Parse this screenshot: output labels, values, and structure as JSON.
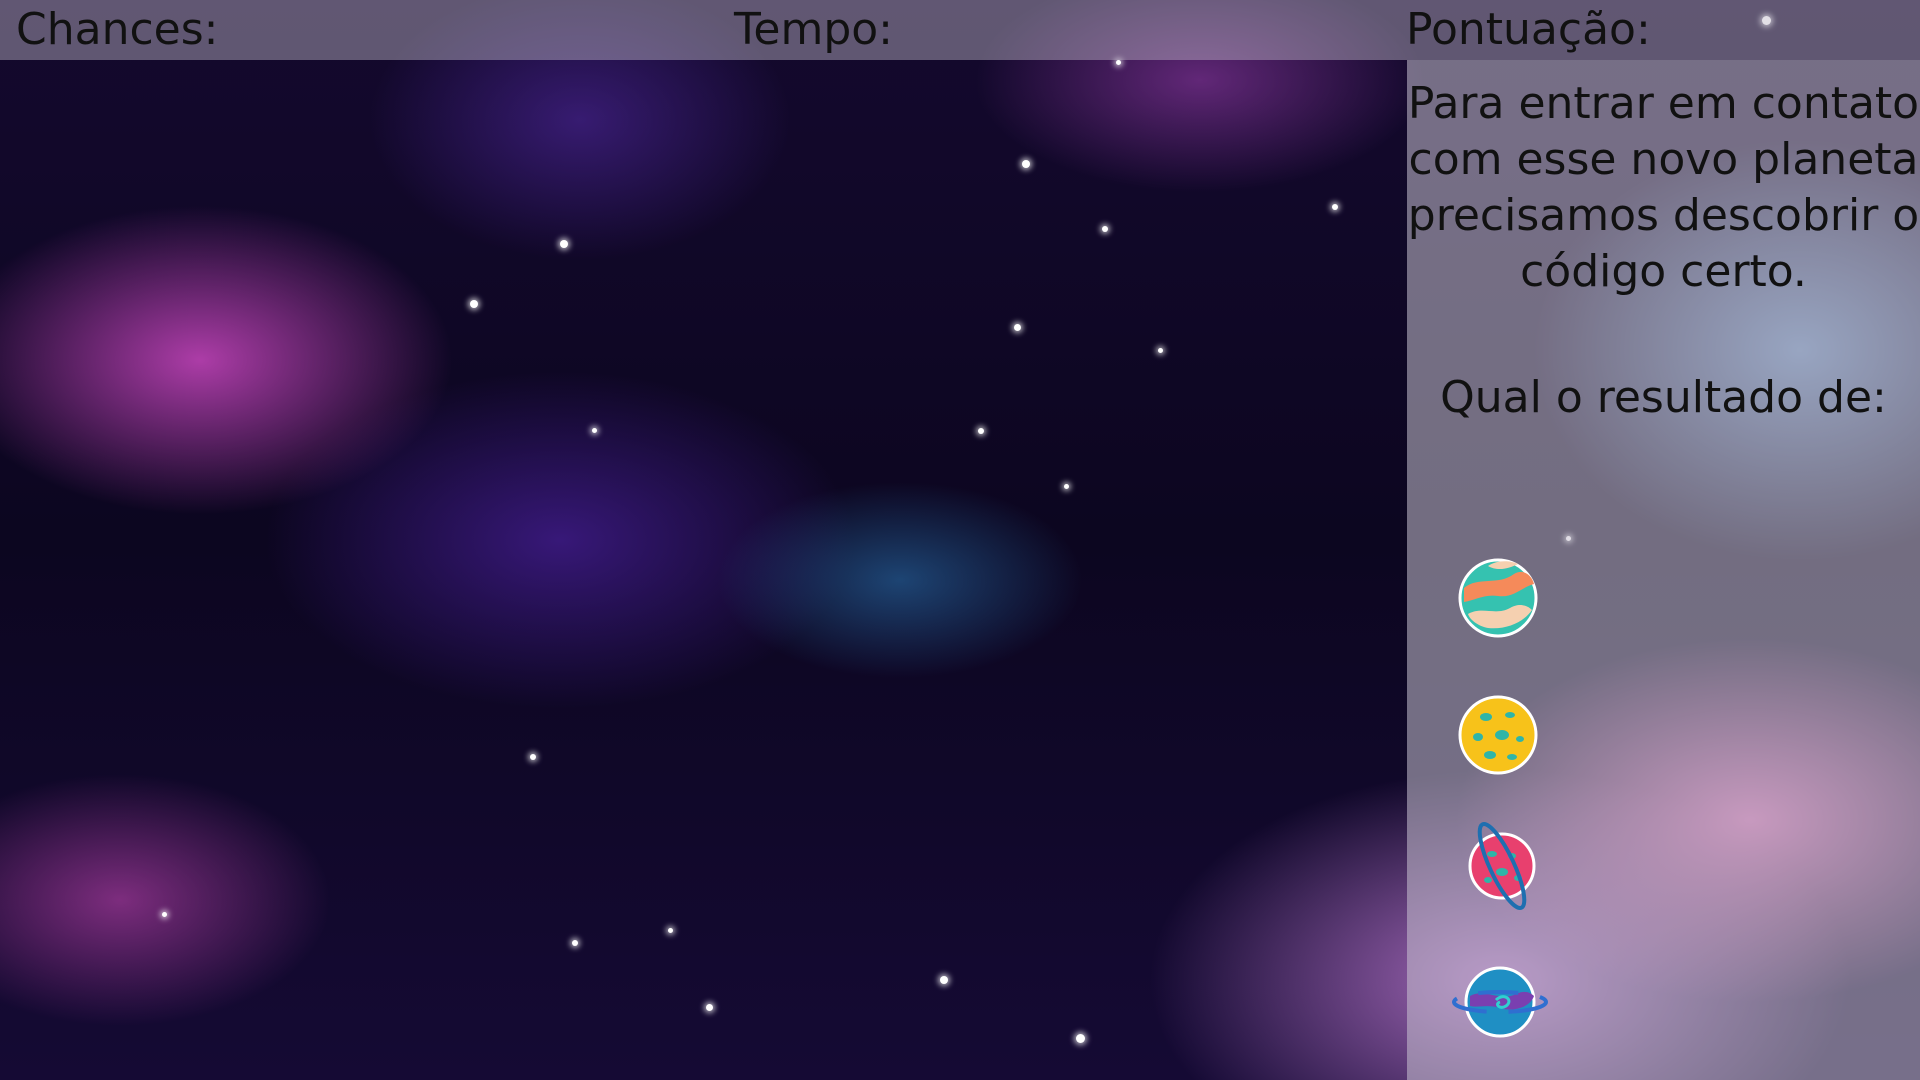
{
  "hud": {
    "chances_label": "Chances:",
    "tempo_label": "Tempo:",
    "score_label": "Pontuação:"
  },
  "panel": {
    "instructions": "Para entrar em contato com esse novo planeta precisamos descobrir o código certo.",
    "question": "Qual o resultado de:"
  },
  "planets": [
    {
      "icon": "swirl-planet-icon",
      "colors": [
        "#35c2b0",
        "#f58a5a",
        "#f5d0b0"
      ]
    },
    {
      "icon": "crater-moon-icon",
      "colors": [
        "#f7c21a",
        "#2fb5a8"
      ]
    },
    {
      "icon": "ringed-pink-planet-icon",
      "colors": [
        "#e8406e",
        "#1e6fb0"
      ]
    },
    {
      "icon": "ringed-blue-planet-icon",
      "colors": [
        "#1f8fc4",
        "#7a3fb0"
      ]
    }
  ]
}
